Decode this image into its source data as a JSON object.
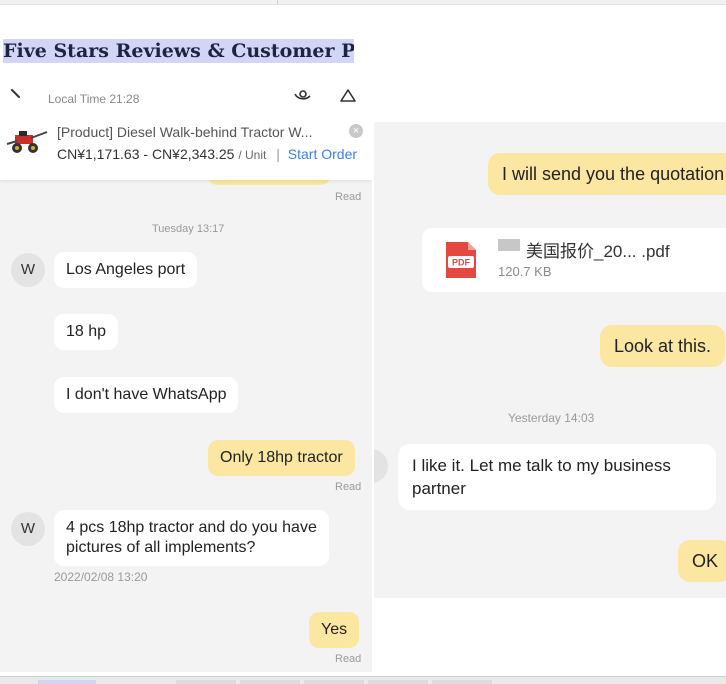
{
  "heading": "Five Stars Reviews & Customer Paid",
  "left_chat": {
    "local_time": "Local Time 21:28",
    "product": {
      "title": "[Product] Diesel Walk-behind Tractor W...",
      "price": "CN¥1,171.63 - CN¥2,343.25",
      "unit": "/ Unit",
      "separator": "|",
      "start_order": "Start Order"
    },
    "read_label": "Read",
    "date_divider": "Tuesday 13:17",
    "avatar_letter": "W",
    "msg_port": "Los Angeles port",
    "msg_hp": "18 hp",
    "msg_whatsapp": "I don't have WhatsApp",
    "msg_only18": "Only 18hp tractor",
    "msg_pictures_line1": "4 pcs 18hp tractor and do you have",
    "msg_pictures_line2": "pictures of all implements?",
    "timestamp": "2022/02/08 13:20",
    "msg_yes": "Yes"
  },
  "right_chat": {
    "msg_quotation": "I will send you the quotation",
    "file": {
      "name": "美国报价_20... .pdf",
      "size": "120.7 KB",
      "icon_label": "PDF"
    },
    "msg_look": "Look at this.",
    "timestamp": "Yesterday 14:03",
    "msg_likeit": "I like it. Let me talk to my business partner",
    "msg_ok": "OK"
  },
  "colors": {
    "heading_highlight": "#d3d5f7",
    "bubble_yellow": "#fbe7a1",
    "link_blue": "#3b82e0",
    "pdf_red": "#e5483f"
  }
}
